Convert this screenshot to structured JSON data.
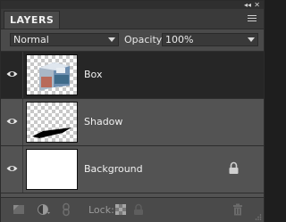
{
  "panel": {
    "title": "LAYERS",
    "blend_mode": "Normal",
    "opacity_label": "Opacity:",
    "opacity_value": "100%"
  },
  "layers": [
    {
      "name": "Box",
      "selected": true,
      "thumbnail": "box-image-thumb"
    },
    {
      "name": "Shadow",
      "selected": false,
      "thumbnail": "shadow-thumb"
    },
    {
      "name": "Background",
      "selected": false,
      "thumbnail": "white-thumb",
      "locked": true
    }
  ],
  "toolbar": {
    "lock_label": "Lock:",
    "icons": [
      "new-layer-icon",
      "fill-adjustment-icon",
      "link-icon",
      "lock-transparency-icon",
      "lock-all-icon",
      "trash-icon"
    ]
  },
  "window_controls": [
    "collapse-icon",
    "close-icon"
  ],
  "colors": {
    "panel_bg": "#4a4a4a",
    "list_bg": "#535353",
    "selected_row": "#262626"
  }
}
